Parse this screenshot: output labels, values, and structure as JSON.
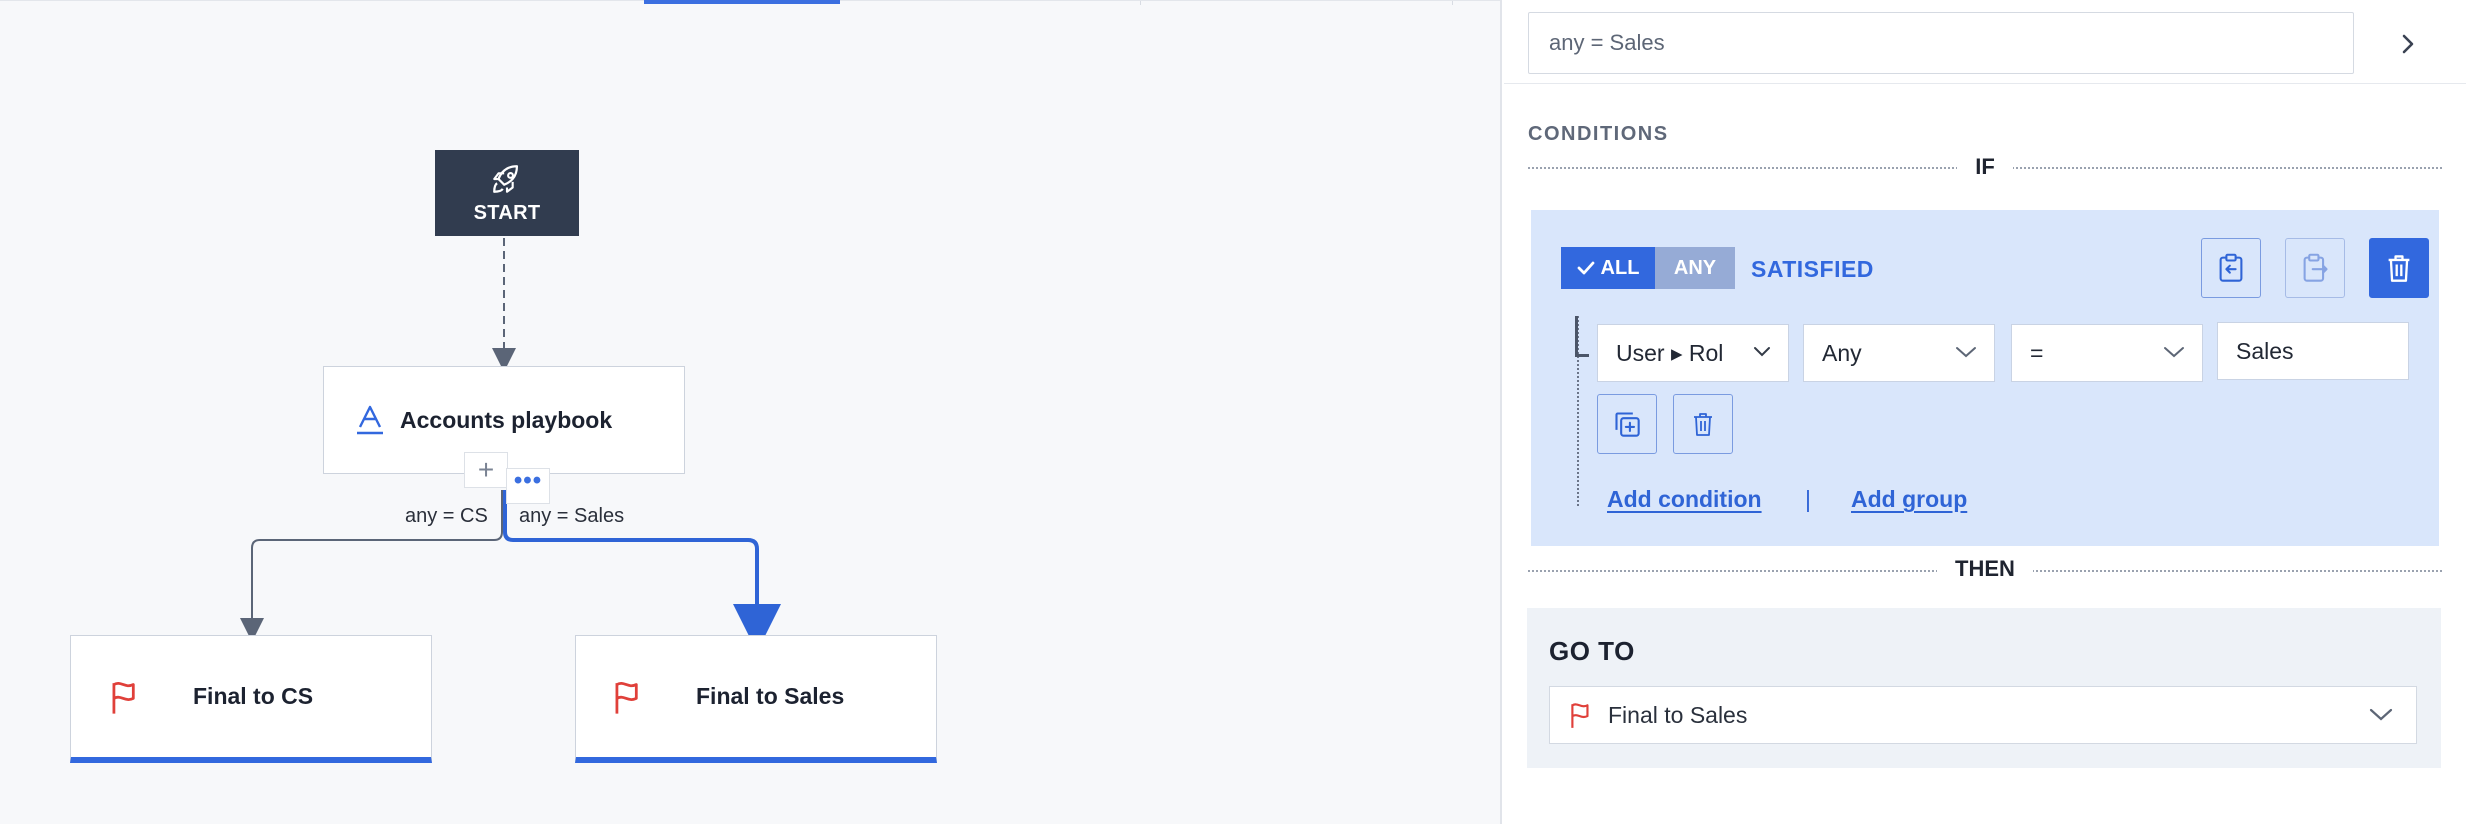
{
  "canvas": {
    "start_label": "START",
    "playbook_label": "Accounts playbook",
    "add_symbol": "+",
    "more_symbol": "•••",
    "edges": [
      {
        "label": "any = CS"
      },
      {
        "label": "any = Sales"
      }
    ],
    "finals": [
      {
        "label": "Final to CS"
      },
      {
        "label": "Final to Sales"
      }
    ]
  },
  "panel": {
    "branch_name_value": "any = Sales",
    "conditions_title": "CONDITIONS",
    "if_label": "IF",
    "then_label": "THEN",
    "toggle": {
      "all_label": "ALL",
      "any_label": "ANY",
      "satisfied_label": "SATISFIED",
      "selected": "ALL"
    },
    "condition": {
      "field": "User ▸ Rol",
      "quantifier": "Any",
      "operator": "=",
      "value": "Sales"
    },
    "add_condition_label": "Add condition",
    "link_separator": "|",
    "add_group_label": "Add group",
    "goto_label": "GO TO",
    "goto_value": "Final to Sales"
  },
  "colors": {
    "accent": "#3268de",
    "flag": "#e0403a",
    "start_bg": "#313c4f",
    "condition_bg": "#d9e6fb"
  },
  "icons": {
    "start": "rocket-icon",
    "playbook": "font-a-icon",
    "final": "flag-icon",
    "next": "chevron-right-icon",
    "copy": "clipboard-copy-icon",
    "paste": "clipboard-export-icon",
    "delete": "trash-icon",
    "duplicate": "duplicate-icon"
  }
}
